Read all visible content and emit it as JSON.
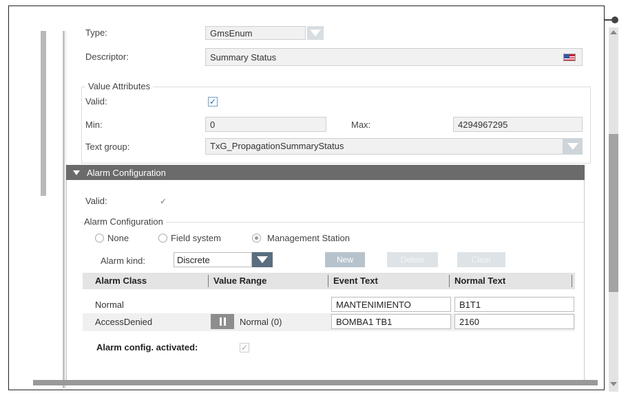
{
  "properties": {
    "type_label": "Type:",
    "type_value": "GmsEnum",
    "descriptor_label": "Descriptor:",
    "descriptor_value": "Summary Status"
  },
  "value_attributes": {
    "title": "Value Attributes",
    "valid_label": "Valid:",
    "valid_checked": true,
    "min_label": "Min:",
    "min_value": "0",
    "max_label": "Max:",
    "max_value": "4294967295",
    "text_group_label": "Text group:",
    "text_group_value": "TxG_PropagationSummaryStatus"
  },
  "alarm_section": {
    "header": "Alarm Configuration",
    "valid_label": "Valid:",
    "group_title": "Alarm Configuration",
    "radio_none": "None",
    "radio_field": "Field system",
    "radio_mgmt": "Management Station",
    "selected_radio": "Management Station",
    "alarm_kind_label": "Alarm kind:",
    "alarm_kind_value": "Discrete",
    "btn_new": "New",
    "btn_delete": "Delete",
    "btn_clear": "Clear",
    "columns": [
      "Alarm Class",
      "Value Range",
      "Event Text",
      "Normal Text"
    ],
    "rows": [
      {
        "alarm_class": "Normal",
        "value_range": "",
        "event_text": "MANTENIMIENTO",
        "normal_text": "B1T1"
      },
      {
        "alarm_class": "AccessDenied",
        "value_range": "Normal (0)",
        "event_text": "BOMBA1 TB1",
        "normal_text": "2160"
      }
    ],
    "activated_label": "Alarm config. activated:"
  },
  "icons": {
    "flag": "us-flag-icon",
    "pin": "pin-icon",
    "checkmark": "checkmark-icon",
    "dropdown": "chevron-down-icon"
  },
  "colors": {
    "section_header": "#6b6b6b",
    "dropdown_button": "#5a6e80",
    "checkbox_blue": "#2a64b8"
  }
}
